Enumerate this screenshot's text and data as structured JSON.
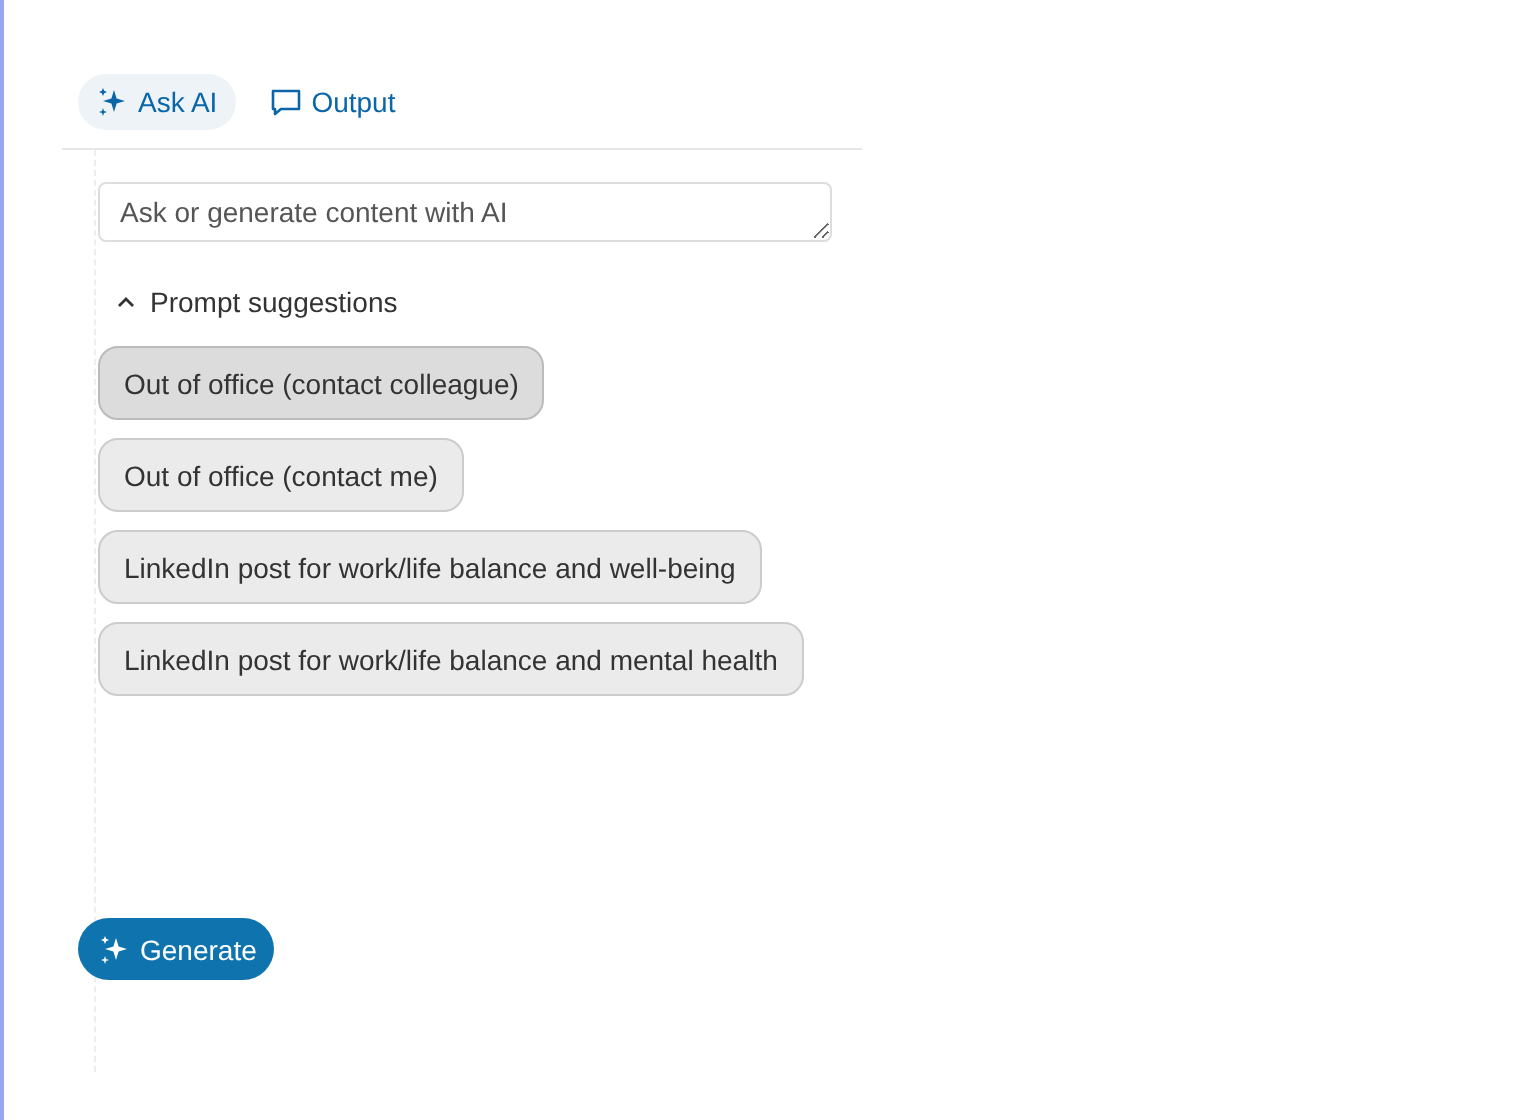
{
  "tabs": [
    {
      "label": "Ask AI",
      "kind": "assistant",
      "selected": true
    },
    {
      "label": "Output",
      "kind": "output",
      "selected": false
    }
  ],
  "prompt_field": {
    "placeholder": "Ask or generate content with AI"
  },
  "suggestions": {
    "label": "Prompt suggestions",
    "expanded": true,
    "items": [
      {
        "label": "Out of office (contact colleague)",
        "hovered": true
      },
      {
        "label": "Out of office (contact me)",
        "hovered": false
      },
      {
        "label": "LinkedIn post for work/life balance and well-being",
        "hovered": false
      },
      {
        "label": "LinkedIn post for work/life balance and mental health",
        "hovered": false
      }
    ]
  },
  "generate_button": {
    "label": "Generate"
  }
}
